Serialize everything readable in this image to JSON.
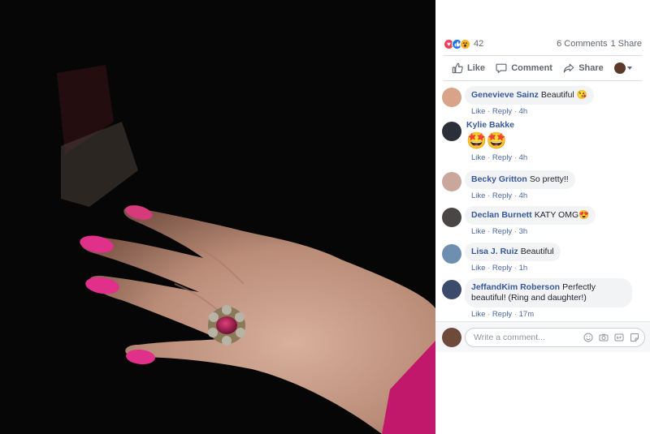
{
  "post": {
    "reaction_icons": [
      "love-icon",
      "like-icon",
      "wow-icon"
    ],
    "reaction_count": "42",
    "comments_count": "6 Comments",
    "shares_count": "1 Share"
  },
  "actions": {
    "like": "Like",
    "comment": "Comment",
    "share": "Share"
  },
  "comments": [
    {
      "author": "Genevieve Sainz",
      "text": "Beautiful 😘",
      "like": "Like",
      "reply": "Reply",
      "time": "4h",
      "avatar_color": "#d9a38a"
    },
    {
      "author": "Kylie Bakke",
      "text": "🤩🤩",
      "like": "Like",
      "reply": "Reply",
      "time": "4h",
      "avatar_color": "#2b2f3a"
    },
    {
      "author": "Becky Gritton",
      "text": "So pretty!!",
      "like": "Like",
      "reply": "Reply",
      "time": "4h",
      "avatar_color": "#c9a79a"
    },
    {
      "author": "Declan Burnett",
      "text": "KATY OMG😍",
      "like": "Like",
      "reply": "Reply",
      "time": "3h",
      "avatar_color": "#4a4646"
    },
    {
      "author": "Lisa J. Ruiz",
      "text": "Beautiful",
      "like": "Like",
      "reply": "Reply",
      "time": "1h",
      "avatar_color": "#6f8fb0"
    },
    {
      "author": "JeffandKim Roberson",
      "text": "Perfectly beautiful! (Ring and daughter!)",
      "like": "Like",
      "reply": "Reply",
      "time": "17m",
      "avatar_color": "#3c4a6b"
    }
  ],
  "composer": {
    "placeholder": "Write a comment..."
  }
}
